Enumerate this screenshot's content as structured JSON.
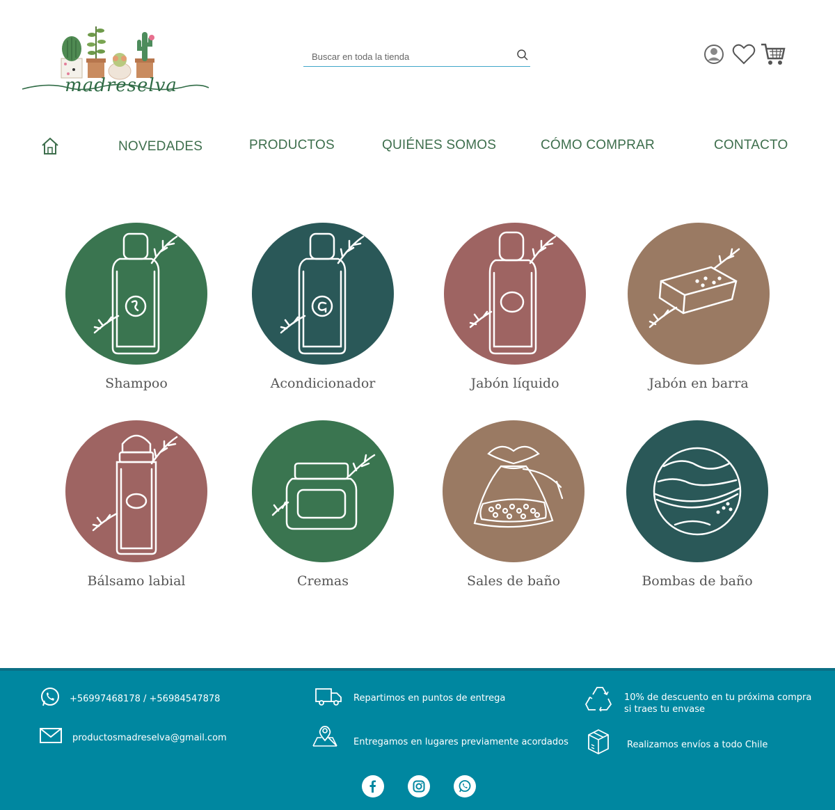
{
  "header": {
    "brand": "madreselva",
    "search_placeholder": "Buscar en toda la tienda"
  },
  "nav": {
    "items": [
      {
        "label": "NOVEDADES"
      },
      {
        "label": "PRODUCTOS"
      },
      {
        "label": "QUIÉNES SOMOS"
      },
      {
        "label": "CÓMO COMPRAR"
      },
      {
        "label": "CONTACTO"
      }
    ]
  },
  "categories": [
    {
      "label": "Shampoo",
      "color": "#3a7550",
      "icon": "shampoo-bottle-icon"
    },
    {
      "label": "Acondicionador",
      "color": "#2a5858",
      "icon": "conditioner-bottle-icon"
    },
    {
      "label": "Jabón líquido",
      "color": "#9e6462",
      "icon": "liquid-soap-bottle-icon"
    },
    {
      "label": "Jabón en barra",
      "color": "#9a7a63",
      "icon": "soap-bar-icon"
    },
    {
      "label": "Bálsamo labial",
      "color": "#9e6462",
      "icon": "lip-balm-icon"
    },
    {
      "label": "Cremas",
      "color": "#3a7550",
      "icon": "cream-jar-icon"
    },
    {
      "label": "Sales de baño",
      "color": "#9a7a63",
      "icon": "bath-salts-bag-icon"
    },
    {
      "label": "Bombas de baño",
      "color": "#2a5858",
      "icon": "bath-bomb-icon"
    }
  ],
  "footer": {
    "phone": "+56997468178 / +56984547878",
    "email": "productosmadreselva@gmail.com",
    "delivery_points": "Repartimos en puntos de entrega",
    "delivery_places": "Entregamos en lugares previamente acordados",
    "discount_line1": "10% de descuento en tu próxima compra",
    "discount_line2": "si traes tu envase",
    "shipping": "Realizamos envíos a todo Chile"
  },
  "colors": {
    "nav_text": "#3d6e4c",
    "footer_bg": "#0087a0"
  }
}
